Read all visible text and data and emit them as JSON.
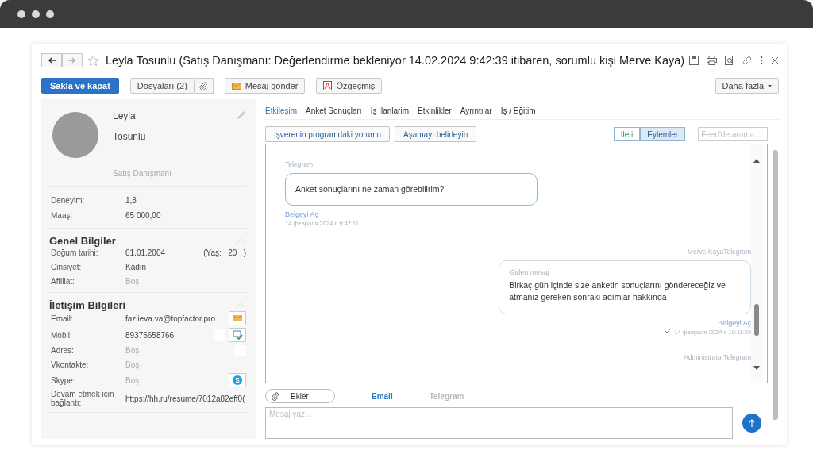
{
  "window": {
    "title": "Leyla Tosunlu (Satış Danışmanı: Değerlendirme bekleniyor 14.02.2024 9:42:39 itibaren, sorumlu kişi Merve Kaya)"
  },
  "toolbar": {
    "buttons": [
      {
        "label": "Sakla ve kapat",
        "kind": "primary"
      },
      {
        "label": "Dosyaları (2)",
        "kind": "files"
      },
      {
        "label": "Mesaj gönder",
        "kind": "mail"
      },
      {
        "label": "Özgeçmiş",
        "kind": "pdf"
      }
    ],
    "more": "Daha fazla"
  },
  "profile": {
    "first_name": "Leyla",
    "last_name": "Tosunlu",
    "position": "Satış Danışmanı"
  },
  "summary": [
    {
      "label": "Deneyim:",
      "value": "1,8"
    },
    {
      "label": "Maaş:",
      "value": "65 000,00"
    }
  ],
  "sections": [
    {
      "title": "Genel Bilgiler",
      "expanded": true,
      "fields": [
        {
          "label": "Doğum tarihi:",
          "value": "01.01.2004",
          "empty": false,
          "age_label": "(Yaş:",
          "age": "20",
          "age_close": ")"
        },
        {
          "label": "Cinsiyet:",
          "value": "Kadın",
          "empty": false
        },
        {
          "label": "Affiliat:",
          "value": "Boş",
          "empty": true
        }
      ]
    },
    {
      "title": "İletişim Bilgileri",
      "expanded": true,
      "fields": [
        {
          "label": "Email:",
          "value": "fazlieva.va@topfactor.pro",
          "empty": false,
          "actions": [
            {
              "kind": "mail"
            }
          ]
        },
        {
          "label": "Mobil:",
          "value": "89375658766",
          "empty": false,
          "actions": [
            {
              "kind": "more",
              "label": "..."
            },
            {
              "kind": "phone"
            }
          ]
        },
        {
          "label": "Adres:",
          "value": "Boş",
          "empty": true,
          "actions": [
            {
              "kind": "more",
              "label": "..."
            }
          ]
        },
        {
          "label": "Vkontakte:",
          "value": "Boş",
          "empty": true
        },
        {
          "label": "Skype:",
          "value": "Boş",
          "empty": true,
          "actions": [
            {
              "kind": "skype"
            }
          ]
        },
        {
          "label": "Devam etmek için bağlantı:",
          "value": "https://hh.ru/resume/7012a82eff0(",
          "empty": false
        }
      ]
    }
  ],
  "tabs": [
    {
      "label": "Etkileşim",
      "selected": true
    },
    {
      "label": "Anket Sonuçları",
      "selected": false
    },
    {
      "label": "İş İlanlarim",
      "selected": false
    },
    {
      "label": "Etkinlikler",
      "selected": false
    },
    {
      "label": "Ayrıntılar",
      "selected": false
    },
    {
      "label": "İş / Eğitim",
      "selected": false
    }
  ],
  "feed_buttons": [
    "İşverenin programdaki yorumu",
    "Aşamayı belirleyin"
  ],
  "view_toggle": [
    {
      "label": "Ileti",
      "selected": false
    },
    {
      "label": "Eylemler",
      "selected": true
    }
  ],
  "feed_search": {
    "placeholder": "Feed'de arama ..."
  },
  "messages": [
    {
      "kind": "incoming",
      "sender": "Telegram",
      "text": "Anket sonuçlarını ne zaman görebilirim?",
      "link": "Belgeyi Aç",
      "time": "14 февраля 2024 г. 9:47:11"
    },
    {
      "kind": "outgoing",
      "sender": "Merve KayaTelegram",
      "label": "Giden mesaj",
      "text": "Birkaç gün içinde size anketin sonuçlarını göndereceğiz ve atmanız gereken sonraki adımlar hakkında",
      "link": "Belgeyi Aç",
      "time": "14 февраля 2024 г. 10:11:29",
      "delivered": true
    },
    {
      "kind": "header",
      "sender": "AdministratorTelegram"
    }
  ],
  "composer": {
    "attach": "Ekler",
    "channels": [
      {
        "label": "Email",
        "selected": true
      },
      {
        "label": "Telegram",
        "selected": false
      }
    ],
    "placeholder": "Mesaj yaz..."
  }
}
